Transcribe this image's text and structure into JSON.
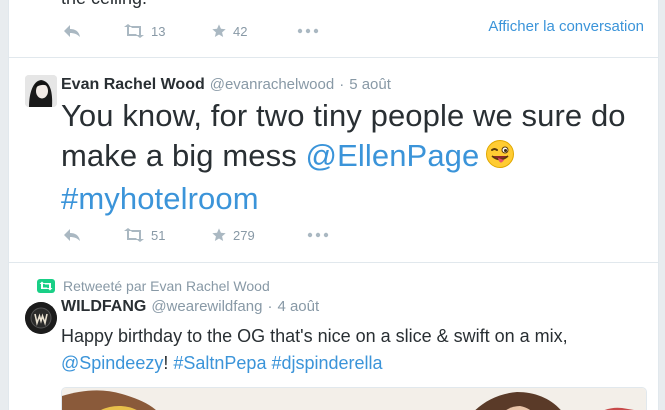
{
  "prev_tweet": {
    "text_fragment": "the ceiling.",
    "retweets": "13",
    "favorites": "42",
    "conversation_link": "Afficher la conversation"
  },
  "tweet1": {
    "name": "Evan Rachel Wood",
    "handle": "@evanrachelwood",
    "dot": "·",
    "time": "5 août",
    "text_main": "You know, for two tiny people we sure do make a big mess",
    "mention": "@EllenPage",
    "hashtag": "#myhotelroom",
    "retweets": "51",
    "favorites": "279"
  },
  "tweet2": {
    "retweet_context": "Retweeté par Evan Rachel Wood",
    "name": "WILDFANG",
    "handle": "@wearewildfang",
    "dot": "·",
    "time": "4 août",
    "text_main": "Happy birthday to the OG that's nice on a slice & swift on a mix,",
    "mention": "@Spindeezy",
    "punct": "!",
    "hashtag1": "#SaltnPepa",
    "hashtag2": "#djspinderella"
  },
  "colors": {
    "link": "#3b94d9",
    "muted": "#8899a6",
    "text": "#292f33",
    "retweet_green": "#19cf86",
    "border": "#e1e8ed"
  },
  "icons": [
    "reply-icon",
    "retweet-icon",
    "favorite-star-icon",
    "more-dots-icon",
    "winking-tongue-emoji",
    "retweet-context-icon"
  ]
}
